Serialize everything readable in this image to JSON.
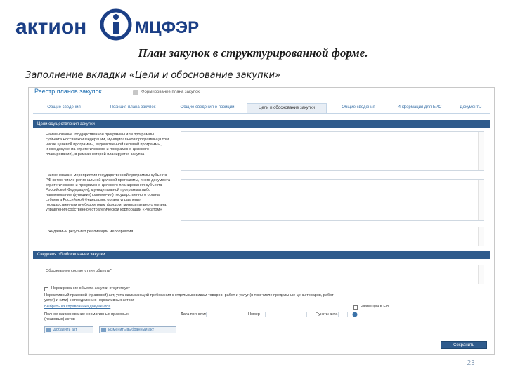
{
  "logo": {
    "left_text": "актион",
    "right_text": "МЦФЭР",
    "primary_color": "#1b3f86"
  },
  "slide": {
    "title": "План закупок в структурированной форме.",
    "subtitle": "Заполнение вкладки «Цели и обоснование закупки»",
    "page_number": "23"
  },
  "screen": {
    "app_title": "Реестр планов закупок",
    "breadcrumb": "Формирование плана закупок",
    "tabs": [
      {
        "label": "Общие сведения"
      },
      {
        "label": "Позиция плана закупок"
      },
      {
        "label": "Общие сведения о позиции"
      },
      {
        "label": "Цели и обоснование закупки"
      },
      {
        "label": "Общие сведения"
      },
      {
        "label": "Информация для ЕИС"
      },
      {
        "label": "Документы"
      }
    ],
    "section1": {
      "title": "Цели осуществления закупки",
      "fields": [
        {
          "label": "Наименование государственной программы или программы субъекта Российской Федерации, муниципальной программы (в том числе целевой программы, ведомственной целевой программы, иного документа стратегического и программно-целевого планирования), в рамках которой планируется закупка"
        },
        {
          "label": "Наименование мероприятия государственной программы субъекта РФ (в том числе региональной целевой программы, иного документа стратегического и программно-целевого планирования субъекта Российской Федерации), муниципальной программы либо наименование функции (полномочия) государственного органа субъекта Российской Федерации, органа управления государственным внебюджетным фондом, муниципального органа, управления собственной стратегической корпорации «Росатом»"
        },
        {
          "label": "Ожидаемый результат реализации мероприятия"
        }
      ]
    },
    "section2": {
      "title": "Сведения об обосновании закупки",
      "field_label": "Обоснование соответствия объекта*",
      "checkbox_label": "Нормирование объекта закупки отсутствует",
      "note_line1": "Нормативный правовой (правовой) акт, устанавливающий требования к отдельным видам товаров, работ и услуг (в том числе предельные цены товаров, работ",
      "note_line2": "услуг) и (или) к определению нормативных затрат",
      "link_label": "Выбрать из справочника документов",
      "eis_checkbox_label": "Размещен в ЕИС",
      "col_date": "Дата принятия",
      "col_number": "Номер",
      "col_paragraph": "Пункты акта",
      "full_name_label": "Полное наименование нормативных правовых (правовых) актов",
      "add_button": "Добавить акт",
      "change_button": "Изменить выбранный акт"
    },
    "save_button": "Сохранить",
    "colors": {
      "section_header": "#2f5b8c",
      "link": "#3b72a8"
    }
  }
}
